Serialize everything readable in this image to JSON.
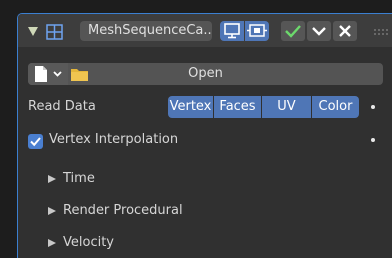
{
  "header": {
    "name_value": "MeshSequenceCa...",
    "icons": [
      "collapse-arrow",
      "modifier-icon",
      "realtime-display-icon",
      "render-icon",
      "apply-icon",
      "dropdown-icon",
      "delete-icon"
    ],
    "accent_color": "#3b7fd0",
    "apply_color": "#6cd96c"
  },
  "file": {
    "open_label": "Open",
    "icons": [
      "file-icon",
      "folder-icon"
    ],
    "folder_color": "#e4b63a"
  },
  "read_data": {
    "label": "Read Data",
    "options": [
      "Vertex",
      "Faces",
      "UV",
      "Color"
    ],
    "selected": [
      "Vertex",
      "Faces",
      "UV",
      "Color"
    ]
  },
  "vertex_interpolation": {
    "label": "Vertex Interpolation",
    "checked": true
  },
  "sections": [
    {
      "label": "Time",
      "expanded": false
    },
    {
      "label": "Render Procedural",
      "expanded": false
    },
    {
      "label": "Velocity",
      "expanded": false
    }
  ]
}
